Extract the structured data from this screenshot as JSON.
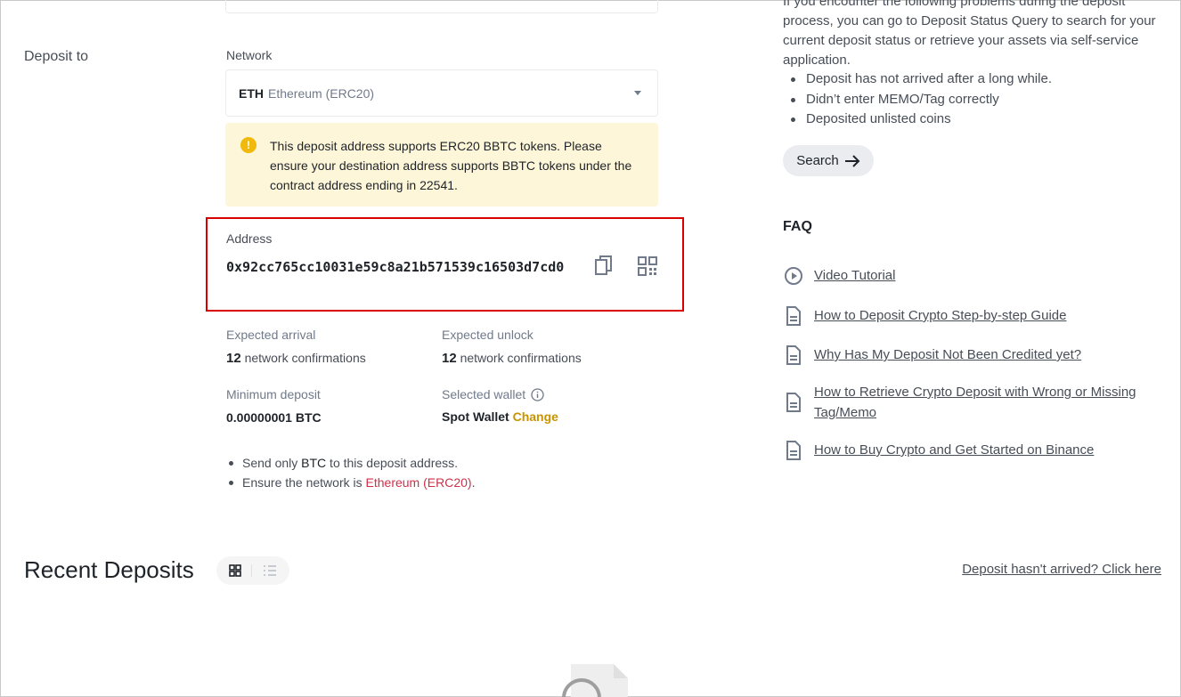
{
  "deposit_to": {
    "label": "Deposit to"
  },
  "network": {
    "label": "Network",
    "selected_symbol": "ETH",
    "selected_name": "Ethereum (ERC20)"
  },
  "warning": {
    "text": "This deposit address supports ERC20 BBTC tokens. Please ensure your destination address supports BBTC tokens under the contract address ending in 22541."
  },
  "address": {
    "label": "Address",
    "value": "0x92cc765cc10031e59c8a21b571539c16503d7cd0"
  },
  "info": {
    "expected_arrival_label": "Expected arrival",
    "expected_arrival_count": "12",
    "expected_arrival_unit": "network confirmations",
    "expected_unlock_label": "Expected unlock",
    "expected_unlock_count": "12",
    "expected_unlock_unit": "network confirmations",
    "minimum_deposit_label": "Minimum deposit",
    "minimum_deposit_value": "0.00000001 BTC",
    "selected_wallet_label": "Selected wallet",
    "selected_wallet_value": "Spot Wallet",
    "change_label": "Change"
  },
  "notes": {
    "line1_prefix": "Send only ",
    "line1_coin": "BTC",
    "line1_suffix": " to this deposit address.",
    "line2_prefix": "Ensure the network is ",
    "line2_network": "Ethereum (ERC20)",
    "line2_suffix": "."
  },
  "right": {
    "intro": "If you encounter the following problems during the deposit process, you can go to Deposit Status Query to search for your current deposit status or retrieve your assets via self-service application.",
    "problems": [
      "Deposit has not arrived after a long while.",
      "Didn’t enter MEMO/Tag correctly",
      "Deposited unlisted coins"
    ],
    "search_label": "Search"
  },
  "faq": {
    "title": "FAQ",
    "items": [
      {
        "label": "Video Tutorial",
        "icon": "play-circle-icon"
      },
      {
        "label": "How to Deposit Crypto Step-by-step Guide",
        "icon": "document-icon"
      },
      {
        "label": "Why Has My Deposit Not Been Credited yet?",
        "icon": "document-icon"
      },
      {
        "label": "How to Retrieve Crypto Deposit with Wrong or Missing Tag/Memo",
        "icon": "document-icon"
      },
      {
        "label": "How to Buy Crypto and Get Started on Binance",
        "icon": "document-icon"
      }
    ]
  },
  "recent": {
    "title": "Recent Deposits",
    "not_arrived_link": "Deposit hasn't arrived? Click here"
  },
  "colors": {
    "accent": "#c99400",
    "warning_bg": "#fef6d8",
    "warning_icon": "#f0b90b",
    "highlight_box": "#d90000",
    "network_red": "#cf304a"
  }
}
